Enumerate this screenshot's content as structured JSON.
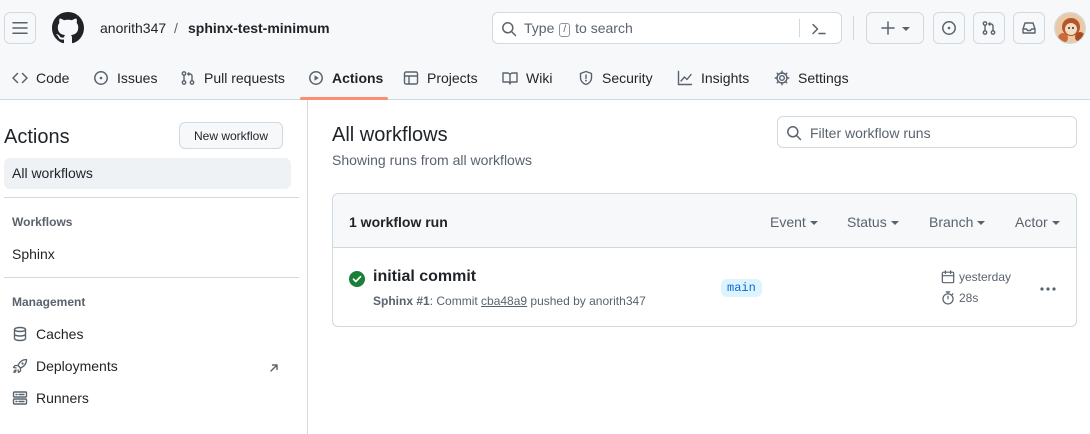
{
  "header": {
    "owner": "anorith347",
    "separator": "/",
    "repo": "sphinx-test-minimum",
    "search": {
      "before": "Type",
      "key": "/",
      "after": "to search"
    }
  },
  "repo_nav": {
    "items": [
      {
        "label": "Code",
        "icon": "code-icon"
      },
      {
        "label": "Issues",
        "icon": "issue-icon"
      },
      {
        "label": "Pull requests",
        "icon": "pull-request-icon"
      },
      {
        "label": "Actions",
        "icon": "play-icon",
        "active": true
      },
      {
        "label": "Projects",
        "icon": "table-icon"
      },
      {
        "label": "Wiki",
        "icon": "book-icon"
      },
      {
        "label": "Security",
        "icon": "shield-icon"
      },
      {
        "label": "Insights",
        "icon": "graph-icon"
      },
      {
        "label": "Settings",
        "icon": "gear-icon"
      }
    ],
    "active_color": "#fd8c73"
  },
  "sidebar": {
    "title": "Actions",
    "new_workflow": "New workflow",
    "all_workflows": "All workflows",
    "workflows_heading": "Workflows",
    "workflows": [
      "Sphinx"
    ],
    "management_heading": "Management",
    "management": [
      {
        "label": "Caches",
        "icon": "database-icon"
      },
      {
        "label": "Deployments",
        "icon": "rocket-icon",
        "external": true
      },
      {
        "label": "Runners",
        "icon": "server-icon"
      }
    ]
  },
  "main": {
    "title": "All workflows",
    "subtitle": "Showing runs from all workflows",
    "filter_placeholder": "Filter workflow runs",
    "runs_count": "1 workflow run",
    "filters": [
      "Event",
      "Status",
      "Branch",
      "Actor"
    ],
    "runs": [
      {
        "title": "initial commit",
        "workflow": "Sphinx #1",
        "meta_commit": ": Commit ",
        "sha": "cba48a9",
        "meta_pushed": " pushed by anorith347",
        "branch": "main",
        "date": "yesterday",
        "duration": "28s",
        "status": "success",
        "status_color": "#1a7f37"
      }
    ]
  },
  "colors": {
    "badge_bg": "#ddf4ff",
    "badge_fg": "#0969da"
  }
}
